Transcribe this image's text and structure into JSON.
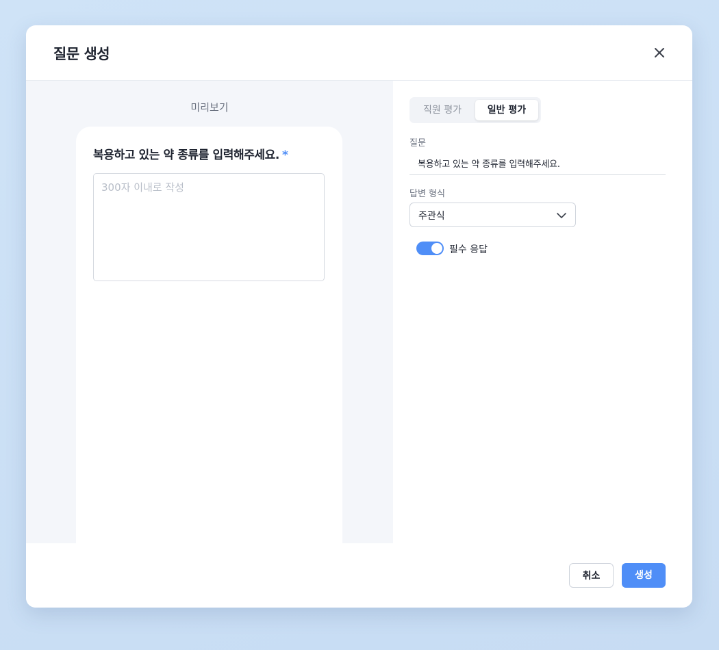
{
  "modal": {
    "title": "질문 생성"
  },
  "preview": {
    "label": "미리보기",
    "question": "복용하고 있는 약 종류를 입력해주세요.",
    "required_mark": "*",
    "answer_placeholder": "300자 이내로 작성"
  },
  "form": {
    "tabs": [
      {
        "label": "직원 평가",
        "active": false
      },
      {
        "label": "일반 평가",
        "active": true
      }
    ],
    "question_label": "질문",
    "question_value": "복용하고 있는 약 종류를 입력해주세요.",
    "answer_type_label": "답변 형식",
    "answer_type_value": "주관식",
    "required_label": "필수 응답",
    "required_on": true
  },
  "footer": {
    "cancel_label": "취소",
    "create_label": "생성"
  },
  "colors": {
    "accent": "#4f8ef7",
    "background": "#cfe3f7"
  }
}
